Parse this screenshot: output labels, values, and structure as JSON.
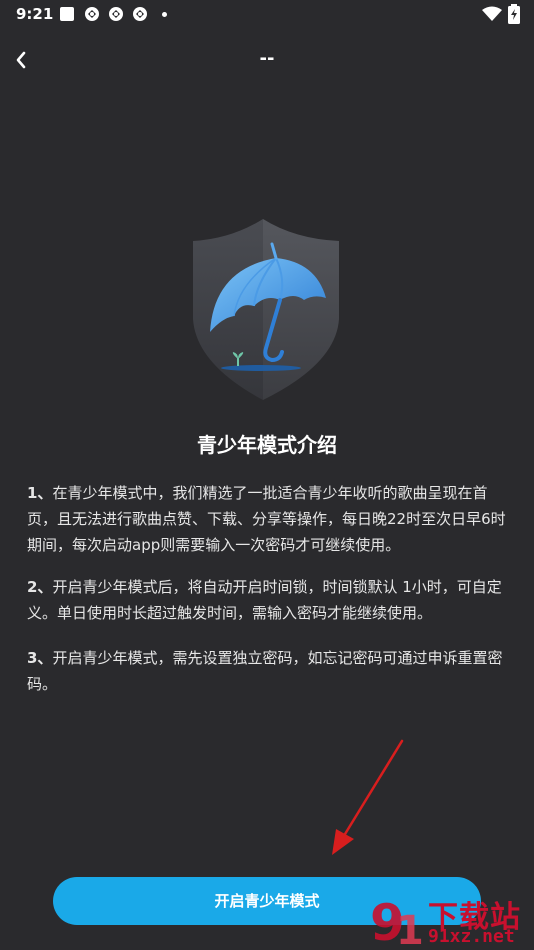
{
  "status_bar": {
    "time": "9:21"
  },
  "header": {
    "title": "--"
  },
  "intro": {
    "title": "青少年模式介绍",
    "paragraphs": [
      {
        "num": "1、",
        "text": "在青少年模式中，我们精选了一批适合青少年收听的歌曲呈现在首页，且无法进行歌曲点赞、下载、分享等操作，每日晚22时至次日早6时期间，每次启动app则需要输入一次密码才可继续使用。"
      },
      {
        "num": "2、",
        "text": "开启青少年模式后，将自动开启时间锁，时间锁默认 1小时，可自定义。单日使用时长超过触发时间，需输入密码才能继续使用。"
      },
      {
        "num": "3、",
        "text": "开启青少年模式，需先设置独立密码，如忘记密码可通过申诉重置密码。"
      }
    ]
  },
  "actions": {
    "enable_label": "开启青少年模式"
  },
  "watermark": {
    "line1": "下载站",
    "line2": "91xz.net"
  },
  "colors": {
    "background": "#2a2a2d",
    "accent": "#1aa9e8",
    "watermark": "#c8102e",
    "annotation_arrow": "#d81e1e"
  },
  "icons": {
    "back": "chevron-left-icon",
    "illustration": "shield-umbrella-icon",
    "wifi": "wifi-icon",
    "battery": "battery-charging-icon"
  }
}
